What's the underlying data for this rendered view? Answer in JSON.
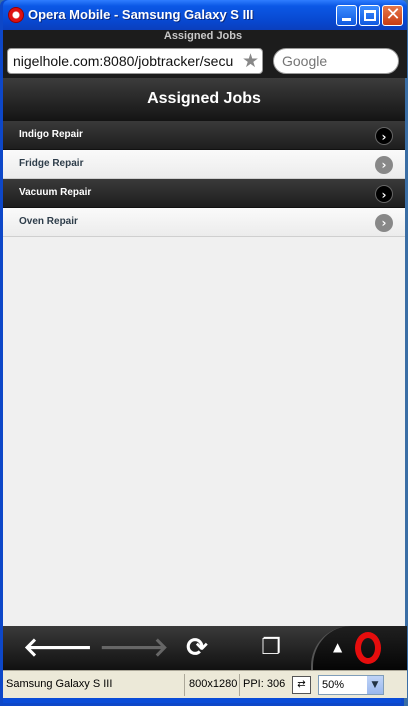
{
  "window": {
    "title": "Opera Mobile - Samsung Galaxy S III"
  },
  "chrome": {
    "page_title": "Assigned Jobs",
    "url": "nigelhole.com:8080/jobtracker/secu",
    "search_placeholder": "Google"
  },
  "page": {
    "header": "Assigned Jobs",
    "jobs": [
      {
        "label": "Indigo Repair"
      },
      {
        "label": "Fridge Repair"
      },
      {
        "label": "Vacuum Repair"
      },
      {
        "label": "Oven Repair"
      }
    ]
  },
  "statusbar": {
    "device": "Samsung Galaxy S III",
    "resolution": "800x1280",
    "ppi": "PPI: 306",
    "zoom": "50%"
  },
  "icons": {
    "back": "back-arrow-icon",
    "forward": "forward-arrow-icon",
    "reload": "reload-icon",
    "tabs": "tabs-icon",
    "opera": "opera-logo-icon"
  }
}
